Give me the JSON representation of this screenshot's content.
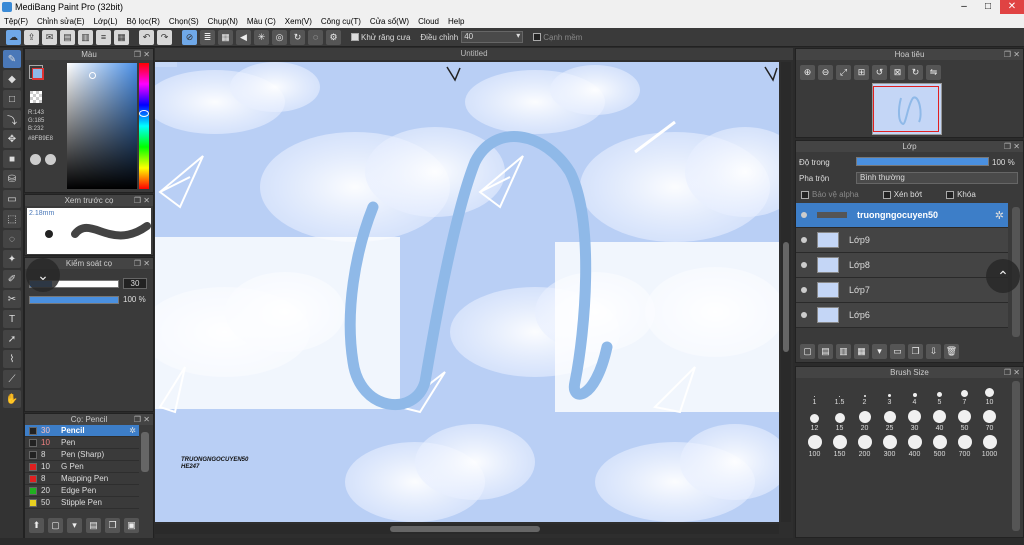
{
  "window": {
    "title": "MediBang Paint Pro (32bit)"
  },
  "menu": [
    "Tệp(F)",
    "Chỉnh sửa(E)",
    "Lớp(L)",
    "Bộ lọc(R)",
    "Chọn(S)",
    "Chụp(N)",
    "Màu (C)",
    "Xem(V)",
    "Công cụ(T)",
    "Cửa sổ(W)",
    "Cloud",
    "Help"
  ],
  "toolbar": {
    "antialias_label": "Khử răng cưa",
    "adjust_label": "Điều chỉnh",
    "adjust_value": "40",
    "edge_label": "Cạnh mềm"
  },
  "color_panel": {
    "title": "Màu",
    "r": "R:143",
    "g": "G:185",
    "b": "B:232",
    "hex": "#8FB9E8",
    "primary": "#8fb9e8",
    "secondary": "#ffffff"
  },
  "preview_panel": {
    "title": "Xem trước cọ",
    "size": "2.18mm"
  },
  "brush_control": {
    "title": "Kiểm soát cọ",
    "size_value": "30",
    "opacity_value": "100 %"
  },
  "brush_list": {
    "title": "Cọ: Pencil",
    "items": [
      {
        "num": "30",
        "name": "Pencil",
        "color": "#222222"
      },
      {
        "num": "10",
        "name": "Pen",
        "color": "#222222"
      },
      {
        "num": "8",
        "name": "Pen (Sharp)",
        "color": "#222222"
      },
      {
        "num": "10",
        "name": "G Pen",
        "color": "#e02020"
      },
      {
        "num": "8",
        "name": "Mapping Pen",
        "color": "#e02020"
      },
      {
        "num": "20",
        "name": "Edge Pen",
        "color": "#20b020"
      },
      {
        "num": "50",
        "name": "Stipple Pen",
        "color": "#e8d020"
      }
    ]
  },
  "canvas": {
    "tab": "Untitled",
    "signature": "TRUONGNGOCUYEN50",
    "signature2": "HE247"
  },
  "navigator": {
    "title": "Hoa tiêu"
  },
  "layers": {
    "title": "Lớp",
    "opacity_label": "Độ trong",
    "opacity_value": "100 %",
    "blend_label": "Pha trộn",
    "blend_value": "Bình thường",
    "protect_alpha": "Bảo vệ alpha",
    "clipping": "Xén bớt",
    "lock": "Khóa",
    "items": [
      {
        "name": "truongngocuyen50"
      },
      {
        "name": "Lớp9"
      },
      {
        "name": "Lớp8"
      },
      {
        "name": "Lớp7"
      },
      {
        "name": "Lớp6"
      }
    ]
  },
  "brush_size": {
    "title": "Brush Size",
    "sizes": [
      "1",
      "1.5",
      "2",
      "3",
      "4",
      "5",
      "7",
      "10",
      "12",
      "15",
      "20",
      "25",
      "30",
      "40",
      "50",
      "70",
      "100",
      "150",
      "200",
      "300",
      "400",
      "500",
      "700",
      "1000"
    ]
  }
}
